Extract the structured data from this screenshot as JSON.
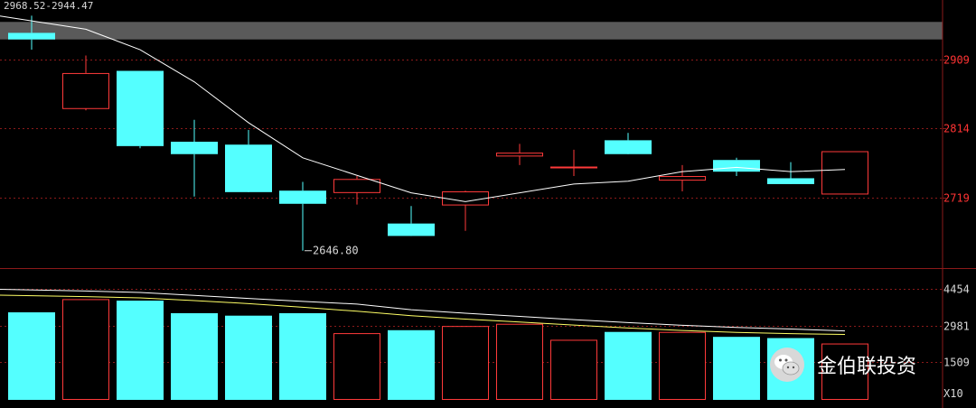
{
  "header": {
    "range_text": "2968.52-2944.47"
  },
  "colors": {
    "up": "#ff3a3a",
    "down": "#54ffff",
    "ma_price": "#ffffff",
    "ma_vol1": "#ffffff",
    "ma_vol2": "#ffff66",
    "grid": "#8b1a1a",
    "axis_text": "#ff3333",
    "bg": "#000000",
    "band": "#5a5a5a"
  },
  "chart_data": [
    {
      "type": "candlestick",
      "y_ticks": [
        "2909",
        "2814",
        "2719"
      ],
      "ylim": [
        2623,
        2990
      ],
      "highlight_band": [
        2936,
        2960
      ],
      "candles": [
        {
          "o": 2945,
          "h": 2968.52,
          "l": 2922,
          "c": 2936
        },
        {
          "o": 2842,
          "h": 2914,
          "l": 2839,
          "c": 2890
        },
        {
          "o": 2893,
          "h": 2893,
          "l": 2787,
          "c": 2790
        },
        {
          "o": 2796,
          "h": 2826,
          "l": 2721,
          "c": 2779
        },
        {
          "o": 2792,
          "h": 2812,
          "l": 2736,
          "c": 2727
        },
        {
          "o": 2729,
          "h": 2741,
          "l": 2646.8,
          "c": 2711
        },
        {
          "o": 2727,
          "h": 2749,
          "l": 2710,
          "c": 2745
        },
        {
          "o": 2684,
          "h": 2708,
          "l": 2679,
          "c": 2667
        },
        {
          "o": 2710,
          "h": 2729,
          "l": 2674,
          "c": 2728
        },
        {
          "o": 2777,
          "h": 2793,
          "l": 2764,
          "c": 2781
        },
        {
          "o": 2761,
          "h": 2785,
          "l": 2749,
          "c": 2762
        },
        {
          "o": 2798,
          "h": 2808,
          "l": 2780,
          "c": 2779
        },
        {
          "o": 2744,
          "h": 2764,
          "l": 2728,
          "c": 2749
        },
        {
          "o": 2771,
          "h": 2774,
          "l": 2749,
          "c": 2755
        },
        {
          "o": 2746,
          "h": 2768,
          "l": 2739,
          "c": 2738
        },
        {
          "o": 2725,
          "h": 2783,
          "l": 2725,
          "c": 2783
        }
      ],
      "ma": [
        2968,
        2950,
        2922,
        2878,
        2822,
        2774,
        2750,
        2726,
        2714,
        2726,
        2738,
        2742,
        2755,
        2761,
        2755,
        2758
      ],
      "min_annotation": "2646.80"
    },
    {
      "type": "bar",
      "y_ticks": [
        "4454",
        "2981",
        "1509"
      ],
      "unit_label": "X10",
      "ylim": [
        0,
        5200
      ],
      "volumes": [
        3515,
        4050,
        3990,
        3480,
        3380,
        3480,
        2670,
        2790,
        2960,
        3050,
        2400,
        2720,
        2720,
        2520,
        2470,
        2250
      ],
      "ma1": [
        4450,
        4380,
        4320,
        4200,
        4080,
        3960,
        3850,
        3620,
        3480,
        3350,
        3220,
        3100,
        2990,
        2900,
        2840,
        2760
      ],
      "ma2": [
        4210,
        4150,
        4100,
        3990,
        3870,
        3720,
        3560,
        3380,
        3240,
        3120,
        3000,
        2880,
        2780,
        2700,
        2650,
        2620
      ]
    }
  ],
  "watermark": {
    "text": "金伯联投资"
  }
}
